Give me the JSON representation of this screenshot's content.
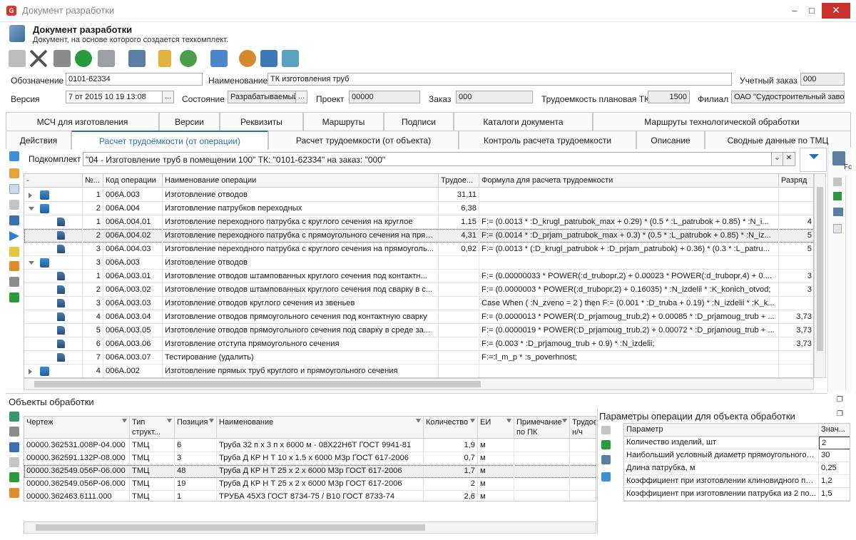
{
  "window": {
    "title": "Документ разработки",
    "minimize": "–",
    "maximize": "□",
    "close": "✕"
  },
  "header": {
    "title": "Документ разработки",
    "subtitle": "Документ, на основе которого создается техкомплект."
  },
  "toolbar": [
    "close-doc-icon",
    "delete-icon",
    "save-icon",
    "refresh-icon",
    "print-icon",
    "tools-icon",
    "lock-icon",
    "approve-icon",
    "export-doc-icon",
    "users-icon",
    "edit-doc-icon",
    "book-icon"
  ],
  "fields": {
    "oboz_label": "Обозначение",
    "oboz_value": "0101-62334",
    "name_label": "Наименование",
    "name_value": "ТК изготовления труб",
    "uchet_label": "Учетный заказ",
    "uchet_value": "000",
    "version_label": "Версия",
    "version_value": "7  от  2015 10 19 13:08",
    "state_label": "Состояние",
    "state_value": "Разрабатываемый",
    "project_label": "Проект",
    "project_value": "00000",
    "order_label": "Заказ",
    "order_value": "000",
    "labor_label": "Трудоемкость плановая ТК",
    "labor_value": "1500",
    "branch_label": "Филиал",
    "branch_value": "ОАО \"Судостроительный завод\"",
    "ellipsis": "…"
  },
  "tabs_row1": [
    "МСЧ для изготовления",
    "Версии",
    "Реквизиты",
    "Маршруты",
    "Подписи",
    "Каталоги документа",
    "Маршруты технологической обработки"
  ],
  "tabs_row2": [
    "Действия",
    "Расчет трудоёмкости (от операции)",
    "Расчет трудоемкости (от объекта)",
    "Контроль расчета трудоемкости",
    "Описание",
    "Сводные данные по ТМЦ"
  ],
  "subkomplekt": {
    "label": "Подкомплект",
    "value": "\"04 - Изготовление труб в помещении 100\" ТК: \"0101-62334\" на заказ: \"000\"",
    "clear": "✕",
    "drop": "⌄"
  },
  "ops_grid": {
    "columns": [
      "-",
      "№...",
      "Код операции",
      "Наименование операции",
      "Трудое...",
      "Формула для расчета трудоемкости",
      "Разряд"
    ],
    "rows": [
      {
        "n": "1",
        "code": "006A.003",
        "name": "Изготовление отводов",
        "labor": "31,11",
        "formula": "",
        "grade": ""
      },
      {
        "n": "2",
        "code": "006A.004",
        "name": "Изготовление патрубков переходных",
        "labor": "6,38",
        "formula": "",
        "grade": ""
      },
      {
        "n": "1",
        "code": "006A.004.01",
        "name": "Изготовление переходного патрубка с круглого сечения на круглое",
        "labor": "1,15",
        "formula": "F:= (0.0013 * :D_krugl_patrubok_max + 0.29) * (0.5 * :L_patrubok + 0.85) * :N_i...",
        "grade": "4"
      },
      {
        "n": "2",
        "code": "006A.004.02",
        "name": "Изготовление переходного патрубка с прямоугольного сечения на прям...",
        "labor": "4,31",
        "formula": "F:= (0.0014 * :D_prjam_patrubok_max + 0.3) * (0.5 * :L_patrubok + 0.85) * :N_iz...",
        "grade": "5"
      },
      {
        "n": "3",
        "code": "006A.004.03",
        "name": "Изготовление переходного патрубка с круглого сечения на прямоуголь...",
        "labor": "0,92",
        "formula": "F:= (0.0013 * (:D_krugl_patrubok + :D_prjam_patrubok) + 0.36) * (0.3 * :L_patru...",
        "grade": "5"
      },
      {
        "n": "3",
        "code": "006A.003",
        "name": "Изготовление отводов",
        "labor": "",
        "formula": "",
        "grade": ""
      },
      {
        "n": "1",
        "code": "006A.003.01",
        "name": "Изготовление отводов штампованных круглого сечения под контактн...",
        "labor": "",
        "formula": "F:= (0.00000033 * POWER(:d_trubopr,2) + 0.00023 * POWER(:d_trubopr,4) + 0....",
        "grade": "3"
      },
      {
        "n": "2",
        "code": "006A.003.02",
        "name": "Изготовление отводов штампованных круглого сечения под сварку в с...",
        "labor": "",
        "formula": "F:= (0.0000003 * POWER(:d_trubopr,2) + 0.16035) * :N_izdelii * :K_konich_otvod;",
        "grade": "3"
      },
      {
        "n": "3",
        "code": "006A.003.03",
        "name": "Изготовление отводов круглого сечения из звеньев",
        "labor": "",
        "formula": "Case When ( :N_zveno = 2 ) then F:= (0.001 * :D_truba + 0.19) * :N_izdelii * :K_k...",
        "grade": ""
      },
      {
        "n": "4",
        "code": "006A.003.04",
        "name": "Изготовление отводов прямоугольного сечения под контактную сварку",
        "labor": "",
        "formula": "F:= (0.0000013 * POWER(:D_prjamoug_trub,2) + 0.00085 * :D_prjamoug_trub + ...",
        "grade": "3,73"
      },
      {
        "n": "5",
        "code": "006A.003.05",
        "name": "Изготовление отводов прямоугольного сечения под сварку в среде за...",
        "labor": "",
        "formula": "F:= (0.0000019 * POWER(:D_prjamoug_trub,2) + 0.00072 * :D_prjamoug_trub + ...",
        "grade": "3,73"
      },
      {
        "n": "6",
        "code": "006A.003.06",
        "name": "Изготовление отступа прямоугольного сечения",
        "labor": "",
        "formula": "F:= (0.003 * :D_prjamoug_trub + 0.9) * :N_izdelii;",
        "grade": "3,73"
      },
      {
        "n": "7",
        "code": "006A.003.07",
        "name": "Тестирование (удалить)",
        "labor": "",
        "formula": "F:=:l_m_p * :s_poverhnost;",
        "grade": ""
      },
      {
        "n": "4",
        "code": "006A.002",
        "name": "Изготовление прямых труб круглого и прямоугольного сечения",
        "labor": "",
        "formula": "",
        "grade": ""
      }
    ]
  },
  "objects": {
    "title": "Объекты обработки",
    "columns": [
      "Чертеж",
      "Тип\nструкт...",
      "Позиция",
      "Наименование",
      "Количество",
      "ЕИ",
      "Примечание\nпо ПК",
      "Трудое\nн/ч"
    ],
    "rows": [
      {
        "drawing": "00000.362531.008Р-04.000",
        "type": "ТМЦ",
        "pos": "6",
        "name": "Труба 32 п х 3 п х 6000 м - 08Х22Н6Т ГОСТ 9941-81",
        "qty": "1,9",
        "unit": "м"
      },
      {
        "drawing": "00000.362591.132Р-08.000",
        "type": "ТМЦ",
        "pos": "3",
        "name": "Труба Д КР Н Т 10 х 1.5 х 6000 М3р ГОСТ 617-2006",
        "qty": "0,7",
        "unit": "м"
      },
      {
        "drawing": "00000.362549.056Р-06.000",
        "type": "ТМЦ",
        "pos": "48",
        "name": "Труба Д КР Н Т 25 х 2 х 6000 М3р ГОСТ 617-2006",
        "qty": "1,7",
        "unit": "м"
      },
      {
        "drawing": "00000.362549.056Р-06.000",
        "type": "ТМЦ",
        "pos": "19",
        "name": "Труба Д КР Н Т 25 х 2 х 6000 М3р ГОСТ 617-2006",
        "qty": "2",
        "unit": "м"
      },
      {
        "drawing": "00000.362463.6111.000",
        "type": "ТМЦ",
        "pos": "1",
        "name": "ТРУБА 45Х3 ГОСТ 8734-75 / В10 ГОСТ 8733-74",
        "qty": "2,6",
        "unit": "м"
      }
    ]
  },
  "params": {
    "title": "Параметры операции для объекта обработки",
    "columns": [
      "Параметр",
      "Знач..."
    ],
    "rows": [
      {
        "name": "Количество изделий, шт",
        "value": "2"
      },
      {
        "name": "Наибольший условный диаметр прямоугольного п...",
        "value": "30"
      },
      {
        "name": "Длина патрубка, м",
        "value": "0,25"
      },
      {
        "name": "Коэффициент при изготовлении клиновидного па...",
        "value": "1,2"
      },
      {
        "name": "Коэффициент при изготовлении патрубка из 2 по...",
        "value": "1,5"
      }
    ]
  },
  "side": {
    "ribbon": "Fc"
  }
}
